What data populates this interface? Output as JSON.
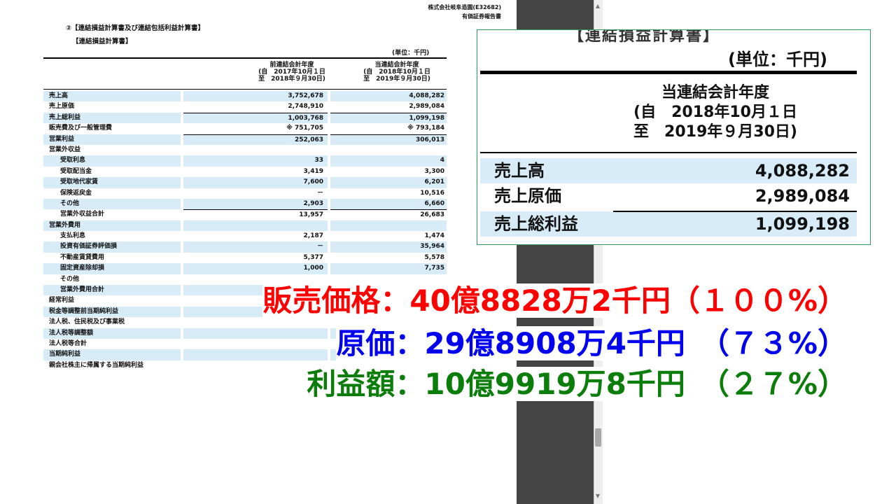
{
  "document": {
    "header": [
      "株式会社岐阜造園(E32682)",
      "有価証券報告書"
    ],
    "section_title": "②【連結損益計算書及び連結包括利益計算書】",
    "sub_title": "【連結損益計算書】",
    "unit": "(単位：千円)",
    "col_prev": [
      "前連結会計年度",
      "(自　2017年10月１日",
      "至　2018年９月30日)"
    ],
    "col_curr": [
      "当連結会計年度",
      "(自　2018年10月１日",
      "至　2019年９月30日)"
    ],
    "rows": [
      {
        "label": "売上高",
        "prev": "3,752,678",
        "curr": "4,088,282"
      },
      {
        "label": "売上原価",
        "prev": "2,748,910",
        "curr": "2,989,084"
      },
      {
        "label": "売上総利益",
        "prev": "1,003,768",
        "curr": "1,099,198"
      },
      {
        "label": "販売費及び一般管理費",
        "prev": "※ 751,705",
        "curr": "※ 793,184"
      },
      {
        "label": "営業利益",
        "prev": "252,063",
        "curr": "306,013"
      },
      {
        "label": "営業外収益",
        "prev": "",
        "curr": ""
      },
      {
        "label": "受取利息",
        "prev": "33",
        "curr": "4"
      },
      {
        "label": "受取配当金",
        "prev": "3,419",
        "curr": "3,300"
      },
      {
        "label": "受取地代家賃",
        "prev": "7,600",
        "curr": "6,201"
      },
      {
        "label": "保険返戻金",
        "prev": "－",
        "curr": "10,516"
      },
      {
        "label": "その他",
        "prev": "2,903",
        "curr": "6,660"
      },
      {
        "label": "営業外収益合計",
        "prev": "13,957",
        "curr": "26,683"
      },
      {
        "label": "営業外費用",
        "prev": "",
        "curr": ""
      },
      {
        "label": "支払利息",
        "prev": "2,187",
        "curr": "1,474"
      },
      {
        "label": "投資有価証券評価損",
        "prev": "－",
        "curr": "35,964"
      },
      {
        "label": "不動産賃貸費用",
        "prev": "5,377",
        "curr": "5,578"
      },
      {
        "label": "固定資産除却損",
        "prev": "1,000",
        "curr": "7,735"
      },
      {
        "label": "その他",
        "prev": "",
        "curr": ""
      },
      {
        "label": "営業外費用合計",
        "prev": "",
        "curr": ""
      },
      {
        "label": "経常利益",
        "prev": "",
        "curr": ""
      },
      {
        "label": "税金等調整前当期純利益",
        "prev": "",
        "curr": ""
      },
      {
        "label": "法人税、住民税及び事業税",
        "prev": "",
        "curr": ""
      },
      {
        "label": "法人税等調整額",
        "prev": "",
        "curr": ""
      },
      {
        "label": "法人税等合計",
        "prev": "",
        "curr": ""
      },
      {
        "label": "当期純利益",
        "prev": "",
        "curr": ""
      },
      {
        "label": "親会社株主に帰属する当期純利益",
        "prev": "",
        "curr": ""
      }
    ]
  },
  "zoom": {
    "cut_title": "【連結損益計算書】",
    "unit": "(単位：千円)",
    "col_head": [
      "当連結会計年度",
      "(自　2018年10月１日",
      "至　2019年９月30日)"
    ],
    "rows": [
      {
        "label": "売上高",
        "value": "4,088,282"
      },
      {
        "label": "売上原価",
        "value": "2,989,084"
      },
      {
        "label": "売上総利益",
        "value": "1,099,198"
      }
    ]
  },
  "overlay": {
    "sales": "販売価格：40億8828万2千円（１００%）",
    "cost": "原価：29億8908万4千円　（７３%）",
    "profit": "利益額：10億9919万8千円　（２７%）"
  },
  "colors": {
    "sales": "#ff0000",
    "cost": "#0000ee",
    "profit": "#0a7d0a",
    "row_shade": "#d8ecf8",
    "zoom_border": "#2a9d5f",
    "gutter": "#444444"
  }
}
